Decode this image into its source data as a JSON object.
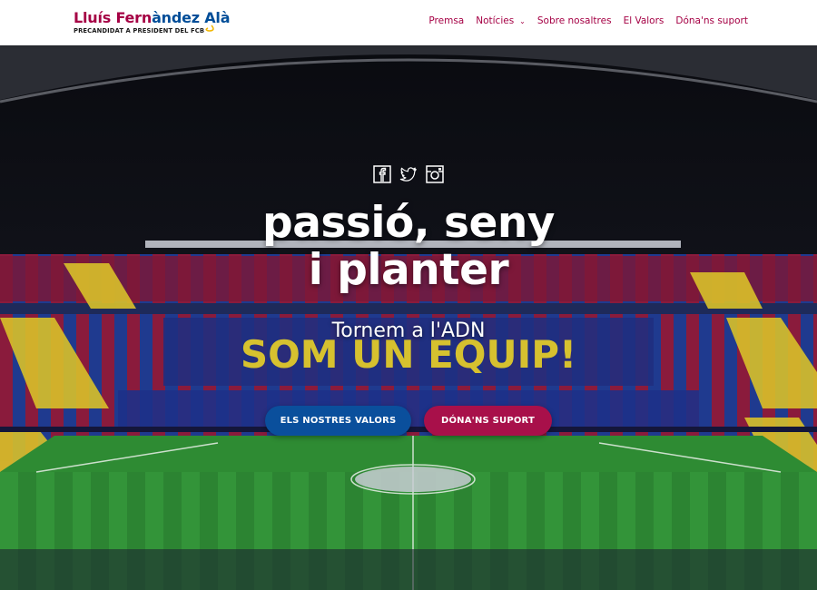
{
  "brand": {
    "name_part1": "Lluís Fern",
    "name_part2": "àndez Alà",
    "tagline": "PRECANDIDAT A PRESIDENT DEL FCB"
  },
  "nav": {
    "items": [
      {
        "label": "Premsa",
        "has_dropdown": false
      },
      {
        "label": "Notícies",
        "has_dropdown": true
      },
      {
        "label": "Sobre nosaltres",
        "has_dropdown": false
      },
      {
        "label": "El Valors",
        "has_dropdown": false
      },
      {
        "label": "Dóna'ns suport",
        "has_dropdown": false
      }
    ]
  },
  "hero": {
    "social_icons": [
      "facebook-icon",
      "twitter-icon",
      "instagram-icon"
    ],
    "headline_line1": "passió, seny",
    "headline_line2": "i planter",
    "subheadline": "Tornem a l'ADN",
    "stand_banner_text": "SOM UN EQUIP!",
    "button_primary": "ELS NOSTRES VALORS",
    "button_secondary": "DÓNA'NS SUPORT"
  },
  "colors": {
    "brand_red": "#a50044",
    "brand_blue": "#004d98",
    "button_blue": "#0a4f9c",
    "button_red": "#a8104a"
  }
}
